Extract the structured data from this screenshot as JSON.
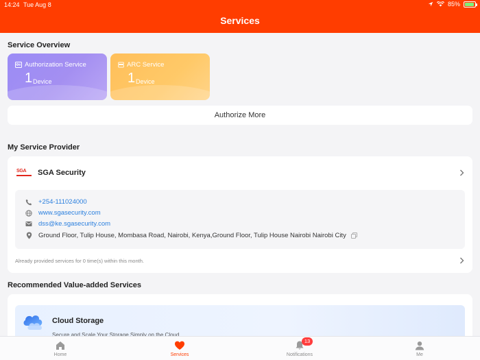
{
  "status_bar": {
    "time": "14:24",
    "date": "Tue Aug 8",
    "battery": "85%"
  },
  "header": {
    "title": "Services"
  },
  "service_overview": {
    "title": "Service Overview",
    "cards": [
      {
        "name": "Authorization Service",
        "count": "1",
        "unit": "Device",
        "icon": "authorization-icon"
      },
      {
        "name": "ARC Service",
        "count": "1",
        "unit": "Device",
        "icon": "arc-icon"
      }
    ],
    "authorize_more": "Authorize More"
  },
  "provider": {
    "section_title": "My Service Provider",
    "logo_text": "SGA",
    "name": "SGA Security",
    "phone": "+254-111024000",
    "website": "www.sgasecurity.com",
    "email": "dss@ke.sgasecurity.com",
    "address": "Ground Floor, Tulip House, Mombasa Road, Nairobi, Kenya,Ground Floor, Tulip House Nairobi Nairobi City",
    "provided_note": "Already provided services for 0 time(s) within this month."
  },
  "recommended": {
    "section_title": "Recommended Value-added Services",
    "items": [
      {
        "title": "Cloud Storage",
        "subtitle": "Secure and Scale Your Storage Simply on the Cloud"
      }
    ]
  },
  "tabbar": {
    "tabs": [
      {
        "label": "Home",
        "icon": "home-icon"
      },
      {
        "label": "Services",
        "icon": "heart-icon",
        "active": true
      },
      {
        "label": "Notifications",
        "icon": "bell-icon",
        "badge": "13"
      },
      {
        "label": "Me",
        "icon": "person-icon"
      }
    ]
  },
  "colors": {
    "brand": "#ff3d00",
    "link": "#2a7fde",
    "auth_card": "#a48ff1",
    "arc_card": "#ffc968"
  }
}
